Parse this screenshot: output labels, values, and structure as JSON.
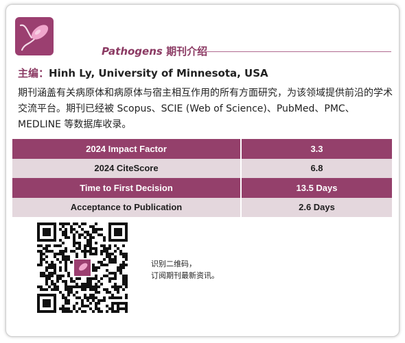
{
  "header": {
    "journal_name": "Pathogens",
    "intro_label": "期刊介绍",
    "logo_icon": "bacterium-icon",
    "accent_color": "#94406b"
  },
  "editor": {
    "label": "主编：",
    "value": "Hinh Ly, University of Minnesota, USA"
  },
  "description": "期刊涵盖有关病原体和病原体与宿主相互作用的所有方面研究，为该领域提供前沿的学术交流平台。期刊已经被 Scopus、SCIE (Web of Science)、PubMed、PMC、MEDLINE 等数据库收录。",
  "metrics": [
    {
      "name": "2024 Impact Factor",
      "value": "3.3"
    },
    {
      "name": "2024 CiteScore",
      "value": "6.8"
    },
    {
      "name": "Time to First Decision",
      "value": "13.5 Days"
    },
    {
      "name": "Acceptance to Publication",
      "value": "2.6 Days"
    }
  ],
  "qr": {
    "caption_line1": "识别二维码，",
    "caption_line2": "订阅期刊最新资讯。"
  }
}
